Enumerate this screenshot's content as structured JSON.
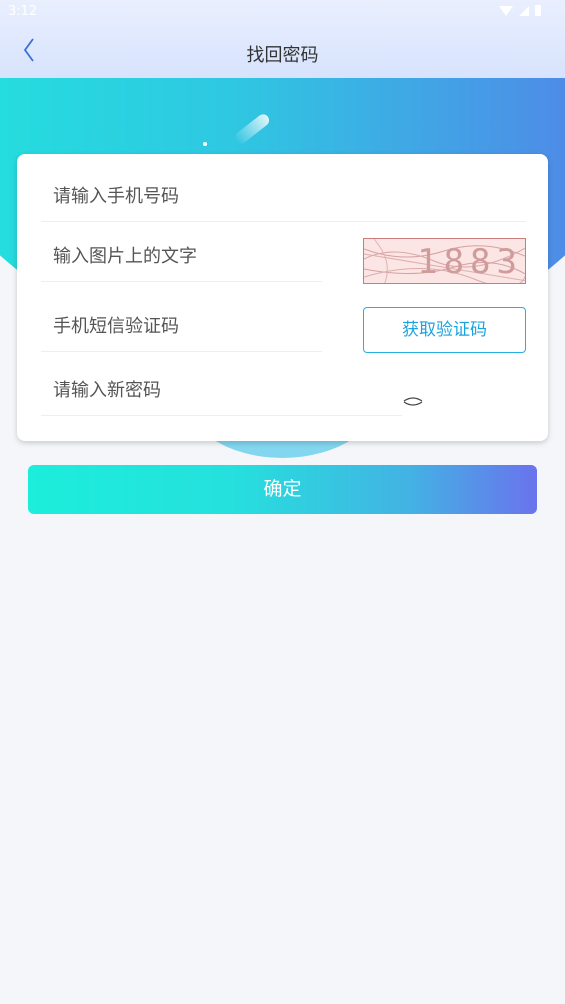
{
  "status_bar": {
    "time": "3:12"
  },
  "header": {
    "title": "找回密码",
    "back_icon": "chevron-left-icon"
  },
  "form": {
    "phone_placeholder": "请输入手机号码",
    "captcha_placeholder": "输入图片上的文字",
    "captcha_image_text": "1883",
    "sms_placeholder": "手机短信验证码",
    "get_code_label": "获取验证码",
    "password_placeholder": "请输入新密码",
    "eye_icon": "eye-closed-icon"
  },
  "actions": {
    "confirm_label": "确定"
  },
  "colors": {
    "accent": "#1aa4df",
    "gradient_start": "#1ceedb",
    "gradient_end": "#6a71ee",
    "captcha_bg": "#fbe5e5"
  }
}
